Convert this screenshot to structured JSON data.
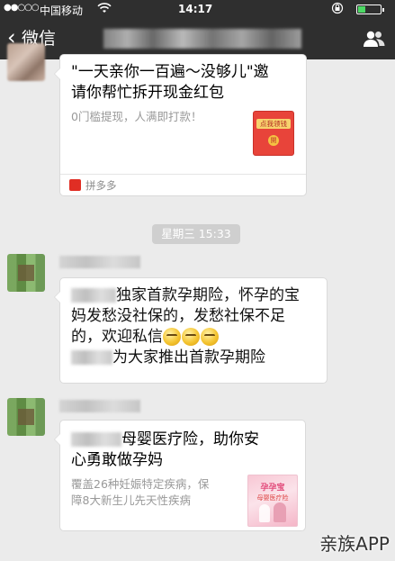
{
  "status_bar": {
    "signal": "●●○○○",
    "carrier": "中国移动",
    "time": "14:17"
  },
  "nav": {
    "back_label": "微信"
  },
  "messages": {
    "card1": {
      "title": "\"一天亲你一百遍～没够儿\"邀请你帮忙拆开现金红包",
      "title_line1": "\"一天亲你一百遍～没够儿\"邀",
      "title_line2": "请你帮忙拆开现金红包",
      "desc": "0门槛提现，人满即打款！",
      "thumb_label": "点我领钱",
      "thumb_coin": "開",
      "source": "拼多多"
    },
    "timestamp": "星期三 15:33",
    "msg2": {
      "line1": "独家首款孕期险，怀孕的宝",
      "line2": "妈发愁没社保的，发愁社保不足",
      "line3": "的，欢迎私信",
      "line4": "为大家推出首款孕期险"
    },
    "card3": {
      "title_line1": "母婴医疗险，助你安",
      "title_line2": "心勇敢做孕妈",
      "desc_line1": "覆盖26种妊娠特定疾病，保",
      "desc_line2": "障8大新生儿先天性疾病",
      "thumb_title": "孕孕宝",
      "thumb_sub": "母婴医疗险"
    }
  },
  "watermark": "亲族APP",
  "colors": {
    "bar_bg": "#2f2f2f",
    "chat_bg": "#ebebeb",
    "red_packet": "#e8443a",
    "pdd_red": "#e02e24"
  }
}
